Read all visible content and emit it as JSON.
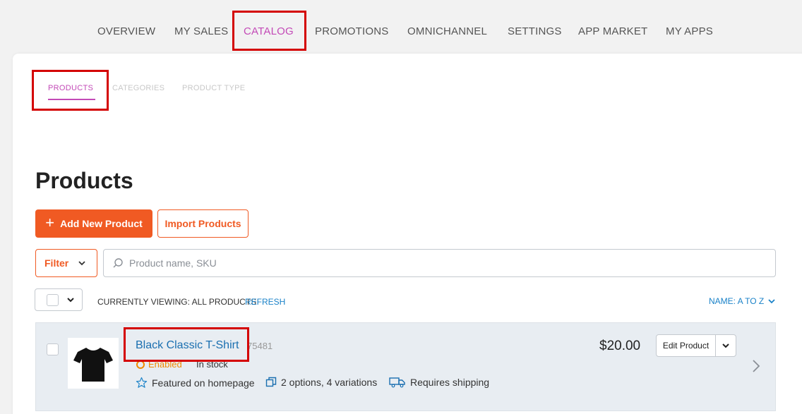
{
  "top_nav": {
    "items": [
      {
        "label": "OVERVIEW"
      },
      {
        "label": "MY SALES"
      },
      {
        "label": "CATALOG",
        "active": true
      },
      {
        "label": "PROMOTIONS"
      },
      {
        "label": "OMNICHANNEL"
      },
      {
        "label": "SETTINGS"
      },
      {
        "label": "APP MARKET"
      },
      {
        "label": "MY APPS"
      }
    ]
  },
  "sub_tabs": [
    {
      "label": "PRODUCTS",
      "active": true
    },
    {
      "label": "CATEGORIES"
    },
    {
      "label": "PRODUCT TYPE"
    }
  ],
  "page": {
    "title": "Products",
    "add_button": "Add New Product",
    "import_button": "Import Products",
    "filter_button": "Filter",
    "search_placeholder": "Product name, SKU"
  },
  "list_header": {
    "viewing": "CURRENTLY VIEWING: ALL PRODUCTS",
    "refresh": "REFRESH",
    "sort": "NAME: A TO Z"
  },
  "product": {
    "name": "Black Classic T-Shirt",
    "sku": "75481",
    "status": "Enabled",
    "stock": "In stock",
    "featured": "Featured on homepage",
    "options": "2 options, 4 variations",
    "shipping": "Requires shipping",
    "price": "$20.00",
    "edit_button": "Edit Product"
  },
  "colors": {
    "accent": "#c34ab7",
    "primary_button": "#f05a23",
    "link": "#1a6fb0",
    "status_enabled": "#f08a00",
    "highlight_box": "#d40000"
  }
}
